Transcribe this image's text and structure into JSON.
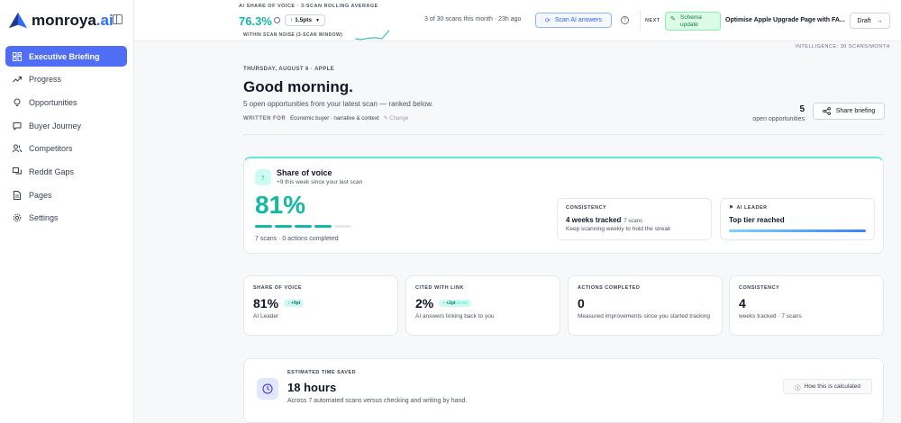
{
  "brand": {
    "name": "monroya",
    "suffix": ".ai"
  },
  "sidebar": {
    "items": [
      {
        "label": "Executive Briefing",
        "icon": "dashboard-icon",
        "active": true
      },
      {
        "label": "Progress",
        "icon": "trend-icon"
      },
      {
        "label": "Opportunities",
        "icon": "lightbulb-icon"
      },
      {
        "label": "Buyer Journey",
        "icon": "chat-icon"
      },
      {
        "label": "Competitors",
        "icon": "users-icon"
      },
      {
        "label": "Reddit Gaps",
        "icon": "messages-icon"
      },
      {
        "label": "Pages",
        "icon": "document-icon"
      },
      {
        "label": "Settings",
        "icon": "gear-icon"
      }
    ]
  },
  "topbar": {
    "sov_label": "AI SHARE OF VOICE · 3-SCAN ROLLING AVERAGE",
    "sov_value": "76.3%",
    "delta": "1.5pts",
    "noise_label": "WITHIN SCAN NOISE (3-SCAN WINDOW)",
    "scan_status": "3 of 30 scans this month · 23h ago",
    "scan_button": "Scan AI answers",
    "next_label": "NEXT",
    "next_badge": "Schema update",
    "next_title": "Optimise Apple Upgrade Page with FA...",
    "draft_button": "Draft",
    "intel_note": "INTELLIGENCE: 30 SCANS/MONTH"
  },
  "header": {
    "date": "THURSDAY, AUGUST 6 · APPLE",
    "greeting": "Good morning.",
    "subtitle": "5 open opportunities from your latest scan — ranked below.",
    "written_for_label": "WRITTEN FOR",
    "written_for_value": "Economic buyer · narrative & context",
    "change_link": "Change",
    "open_count": "5",
    "open_label": "open opportunities",
    "share_button": "Share briefing"
  },
  "hero": {
    "title": "Share of voice",
    "subtitle": "+9 this week since your last scan",
    "value": "81%",
    "segments_filled": 4,
    "segments_total": 5,
    "scans_text": "7 scans · 0 actions completed",
    "consistency": {
      "label": "CONSISTENCY",
      "value": "4 weeks tracked",
      "small": "7 scans",
      "desc": "Keep scanning weekly to hold the streak"
    },
    "leader": {
      "label": "AI LEADER",
      "value": "Top tier reached",
      "progress": 1.0
    }
  },
  "stats": [
    {
      "label": "SHARE OF VOICE",
      "value": "81%",
      "delta": "+9pt",
      "delta_small": "",
      "desc": "AI Leader"
    },
    {
      "label": "CITED WITH LINK",
      "value": "2%",
      "delta": "+2pt",
      "delta_small": "small",
      "desc": "AI answers linking back to you"
    },
    {
      "label": "ACTIONS COMPLETED",
      "value": "0",
      "delta": "",
      "delta_small": "",
      "desc": "Measured improvements since you started tracking"
    },
    {
      "label": "CONSISTENCY",
      "value": "4",
      "delta": "",
      "delta_small": "",
      "desc": "weeks tracked · 7 scans"
    }
  ],
  "time_saved": {
    "label": "ESTIMATED TIME SAVED",
    "value": "18 hours",
    "desc": "Across 7 automated scans versus checking and writing by hand.",
    "button": "How this is calculated"
  },
  "colors": {
    "accent": "#4f6df5",
    "teal": "#14b8a6",
    "brand_blue": "#2f6df6"
  }
}
